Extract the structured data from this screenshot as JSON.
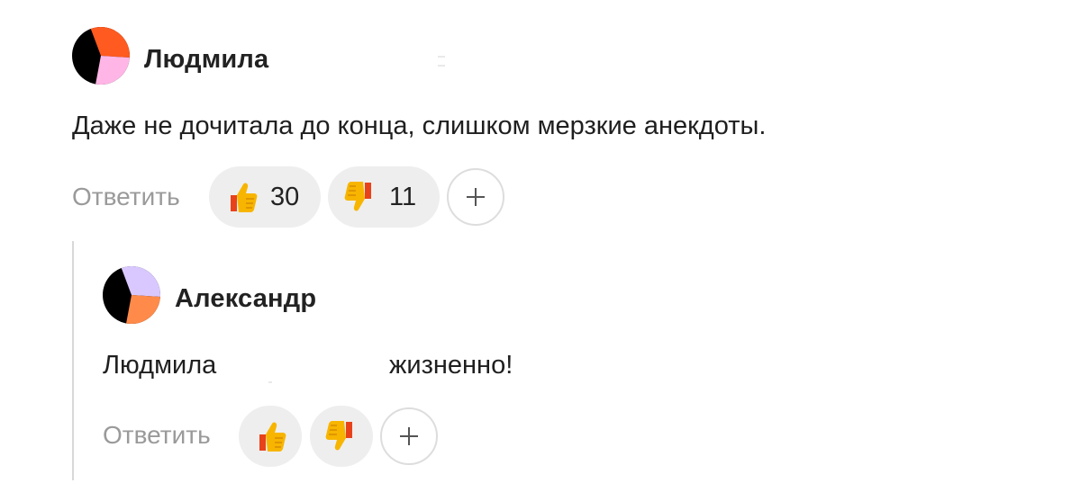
{
  "comment": {
    "author": "Людмила",
    "text": "Даже не дочитала до конца, слишком мерзкие анекдоты.",
    "reply_label": "Ответить",
    "like": {
      "icon": "thumbs-up-icon",
      "count": "30"
    },
    "dislike": {
      "icon": "thumbs-down-icon",
      "count": "11"
    },
    "add_reaction_icon": "plus-icon",
    "avatar_colors": [
      "#000000",
      "#ff5a1f",
      "#ffb6e6"
    ]
  },
  "reply": {
    "author": "Александр",
    "mention": "Людмила",
    "text": "жизненно!",
    "reply_label": "Ответить",
    "like": {
      "icon": "thumbs-up-icon"
    },
    "dislike": {
      "icon": "thumbs-down-icon"
    },
    "add_reaction_icon": "plus-icon",
    "avatar_colors": [
      "#000000",
      "#d9c8ff",
      "#ff8a4a"
    ]
  }
}
